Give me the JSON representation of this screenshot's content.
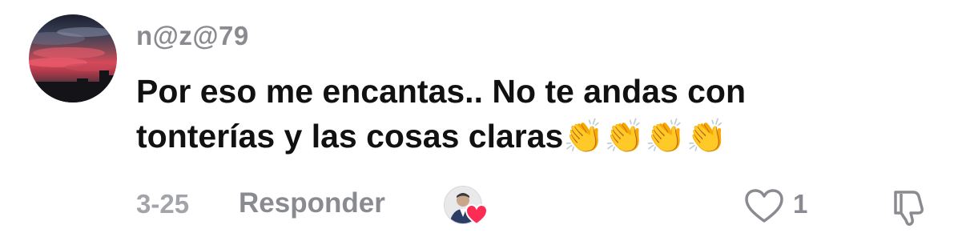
{
  "comment": {
    "username": "n@z@79",
    "text_line1": "Por eso me encantas.. No te andas con",
    "text_line2": "tonterías y las cosas claras",
    "emojis": "👏👏👏👏",
    "date": "3-25",
    "reply_label": "Responder",
    "like_count": "1"
  },
  "icons": {
    "avatar": "user-avatar",
    "creator_liked": "creator-liked-heart-icon",
    "like": "heart-outline-icon",
    "dislike": "thumbs-down-icon"
  },
  "colors": {
    "heart_accent": "#fe2c55",
    "secondary_text": "#8a8b91",
    "primary_text": "#111111"
  }
}
